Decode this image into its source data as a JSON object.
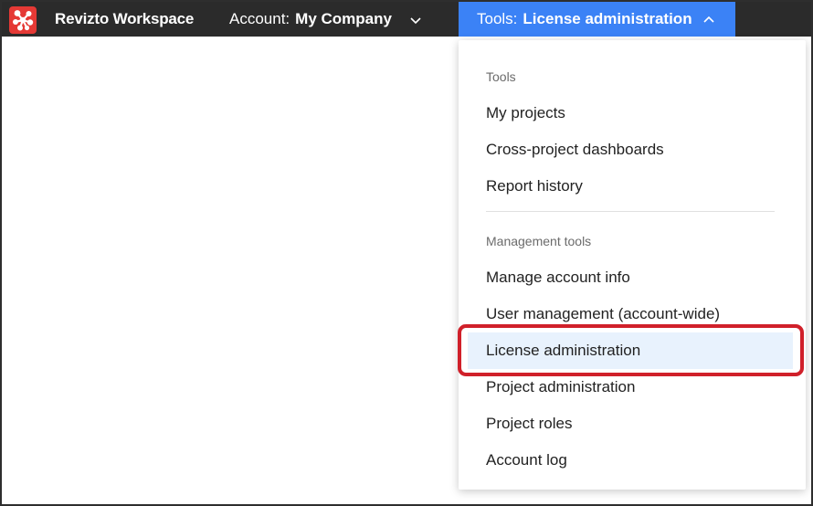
{
  "topbar": {
    "brand": "Revizto Workspace",
    "account_label": "Account:",
    "account_value": "My Company",
    "account_icon": "chevron-down-icon",
    "tools_label": "Tools:",
    "tools_value": "License administration",
    "tools_icon": "chevron-up-icon"
  },
  "menu": {
    "sections": [
      {
        "header": "Tools",
        "items": [
          {
            "label": "My projects"
          },
          {
            "label": "Cross-project dashboards"
          },
          {
            "label": "Report history"
          }
        ]
      },
      {
        "header": "Management tools",
        "items": [
          {
            "label": "Manage account info"
          },
          {
            "label": "User management (account-wide)"
          },
          {
            "label": "License administration",
            "selected": true
          },
          {
            "label": "Project administration"
          },
          {
            "label": "Project roles"
          },
          {
            "label": "Account log"
          }
        ]
      }
    ]
  },
  "colors": {
    "topbar_bg": "#2b2b2b",
    "accent": "#3b82f6",
    "logo_bg": "#e53935",
    "selected_bg": "#e8f2fd",
    "highlight_border": "#d0202a"
  }
}
